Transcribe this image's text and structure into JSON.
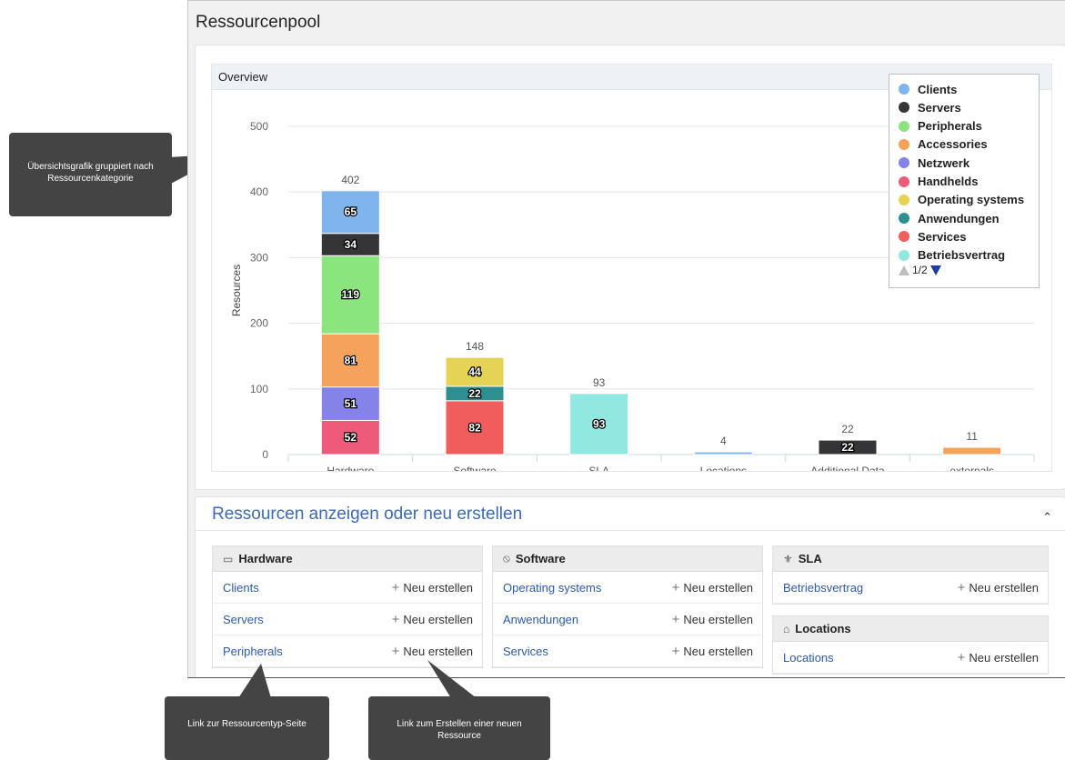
{
  "window": {
    "title": "Ressourcenpool"
  },
  "overview": {
    "title": "Overview"
  },
  "chart_data": {
    "type": "bar",
    "stacked": true,
    "categories": [
      "Hardware",
      "Software",
      "SLA",
      "Locations",
      "Additional Data",
      "externals"
    ],
    "ylabel": "Resources",
    "ylim": [
      0,
      500
    ],
    "yticks": [
      0,
      100,
      200,
      300,
      400,
      500
    ],
    "grid": true,
    "legend_position": "top-right",
    "totals": [
      402,
      148,
      93,
      4,
      22,
      11
    ],
    "series": [
      {
        "name": "Handhelds",
        "color": "#ed5a7a",
        "values": [
          52,
          0,
          0,
          0,
          0,
          0
        ]
      },
      {
        "name": "Netzwerk",
        "color": "#8582e8",
        "values": [
          51,
          0,
          0,
          0,
          0,
          0
        ]
      },
      {
        "name": "Accessories",
        "color": "#f5a25d",
        "values": [
          81,
          0,
          0,
          0,
          0,
          0
        ]
      },
      {
        "name": "Peripherals",
        "color": "#8be57f",
        "values": [
          119,
          0,
          0,
          0,
          0,
          0
        ]
      },
      {
        "name": "Servers",
        "color": "#353538",
        "values": [
          34,
          0,
          0,
          0,
          0,
          0
        ]
      },
      {
        "name": "Clients",
        "color": "#7eb5ec",
        "values": [
          65,
          0,
          0,
          0,
          0,
          0
        ]
      },
      {
        "name": "Services",
        "color": "#f15c5c",
        "values": [
          0,
          82,
          0,
          0,
          0,
          0
        ]
      },
      {
        "name": "Anwendungen",
        "color": "#2b908f",
        "values": [
          0,
          22,
          0,
          0,
          0,
          0
        ]
      },
      {
        "name": "Operating systems",
        "color": "#e4d354",
        "values": [
          0,
          44,
          0,
          0,
          0,
          0
        ]
      },
      {
        "name": "Betriebsvertrag",
        "color": "#91e8e1",
        "values": [
          0,
          0,
          93,
          0,
          0,
          0
        ]
      },
      {
        "name": "Locations",
        "color": "#7eb5ec",
        "values": [
          0,
          0,
          0,
          4,
          0,
          0
        ]
      },
      {
        "name": "Additional Data",
        "color": "#353538",
        "values": [
          0,
          0,
          0,
          0,
          22,
          0
        ]
      },
      {
        "name": "externals",
        "color": "#f5a25d",
        "values": [
          0,
          0,
          0,
          0,
          0,
          11
        ]
      }
    ],
    "segment_labels_shown": [
      [
        0,
        "Handhelds"
      ],
      [
        0,
        "Netzwerk"
      ],
      [
        0,
        "Accessories"
      ],
      [
        0,
        "Peripherals"
      ],
      [
        0,
        "Servers"
      ],
      [
        0,
        "Clients"
      ],
      [
        1,
        "Services"
      ],
      [
        1,
        "Anwendungen"
      ],
      [
        1,
        "Operating systems"
      ],
      [
        2,
        "Betriebsvertrag"
      ],
      [
        4,
        "Additional Data"
      ]
    ]
  },
  "legend": {
    "items": [
      {
        "label": "Clients",
        "color": "#7eb5ec"
      },
      {
        "label": "Servers",
        "color": "#353538"
      },
      {
        "label": "Peripherals",
        "color": "#8be57f"
      },
      {
        "label": "Accessories",
        "color": "#f5a25d"
      },
      {
        "label": "Netzwerk",
        "color": "#8582e8"
      },
      {
        "label": "Handhelds",
        "color": "#ed5a7a"
      },
      {
        "label": "Operating systems",
        "color": "#e4d354"
      },
      {
        "label": "Anwendungen",
        "color": "#2b908f"
      },
      {
        "label": "Services",
        "color": "#f15c5c"
      },
      {
        "label": "Betriebsvertrag",
        "color": "#91e8e1"
      }
    ],
    "page": "1/2"
  },
  "resources": {
    "title": "Ressourcen anzeigen oder neu erstellen",
    "new_label": "Neu erstellen",
    "groups": [
      {
        "name": "Hardware",
        "icon": "monitor-icon",
        "items": [
          "Clients",
          "Servers",
          "Peripherals"
        ]
      },
      {
        "name": "Software",
        "icon": "software-icon",
        "items": [
          "Operating systems",
          "Anwendungen",
          "Services"
        ]
      },
      {
        "name": "SLA",
        "icon": "handshake-icon",
        "items": [
          "Betriebsvertrag"
        ]
      },
      {
        "name": "Locations",
        "icon": "home-icon",
        "items": [
          "Locations"
        ]
      }
    ]
  },
  "callouts": {
    "chart": "Übersichtsgrafik gruppiert nach Ressourcenkategorie",
    "link_type": "Link zur Ressourcentyp-Seite",
    "link_create": "Link zum Erstellen einer neuen Ressource"
  }
}
